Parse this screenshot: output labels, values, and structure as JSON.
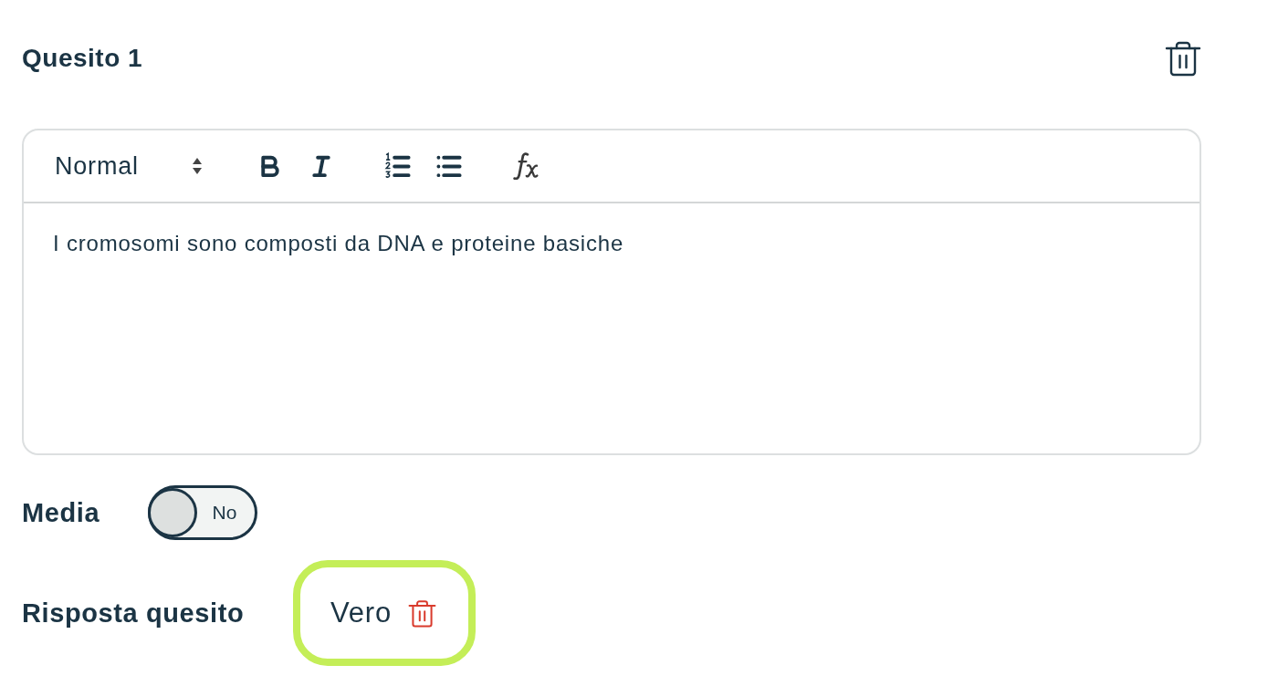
{
  "question": {
    "title": "Quesito 1"
  },
  "editor": {
    "format": "Normal",
    "content": "I cromosomi sono composti da DNA e proteine basiche"
  },
  "media": {
    "label": "Media",
    "on": false,
    "state_label": "No"
  },
  "answer": {
    "label": "Risposta quesito",
    "value": "Vero",
    "selected": true
  }
}
